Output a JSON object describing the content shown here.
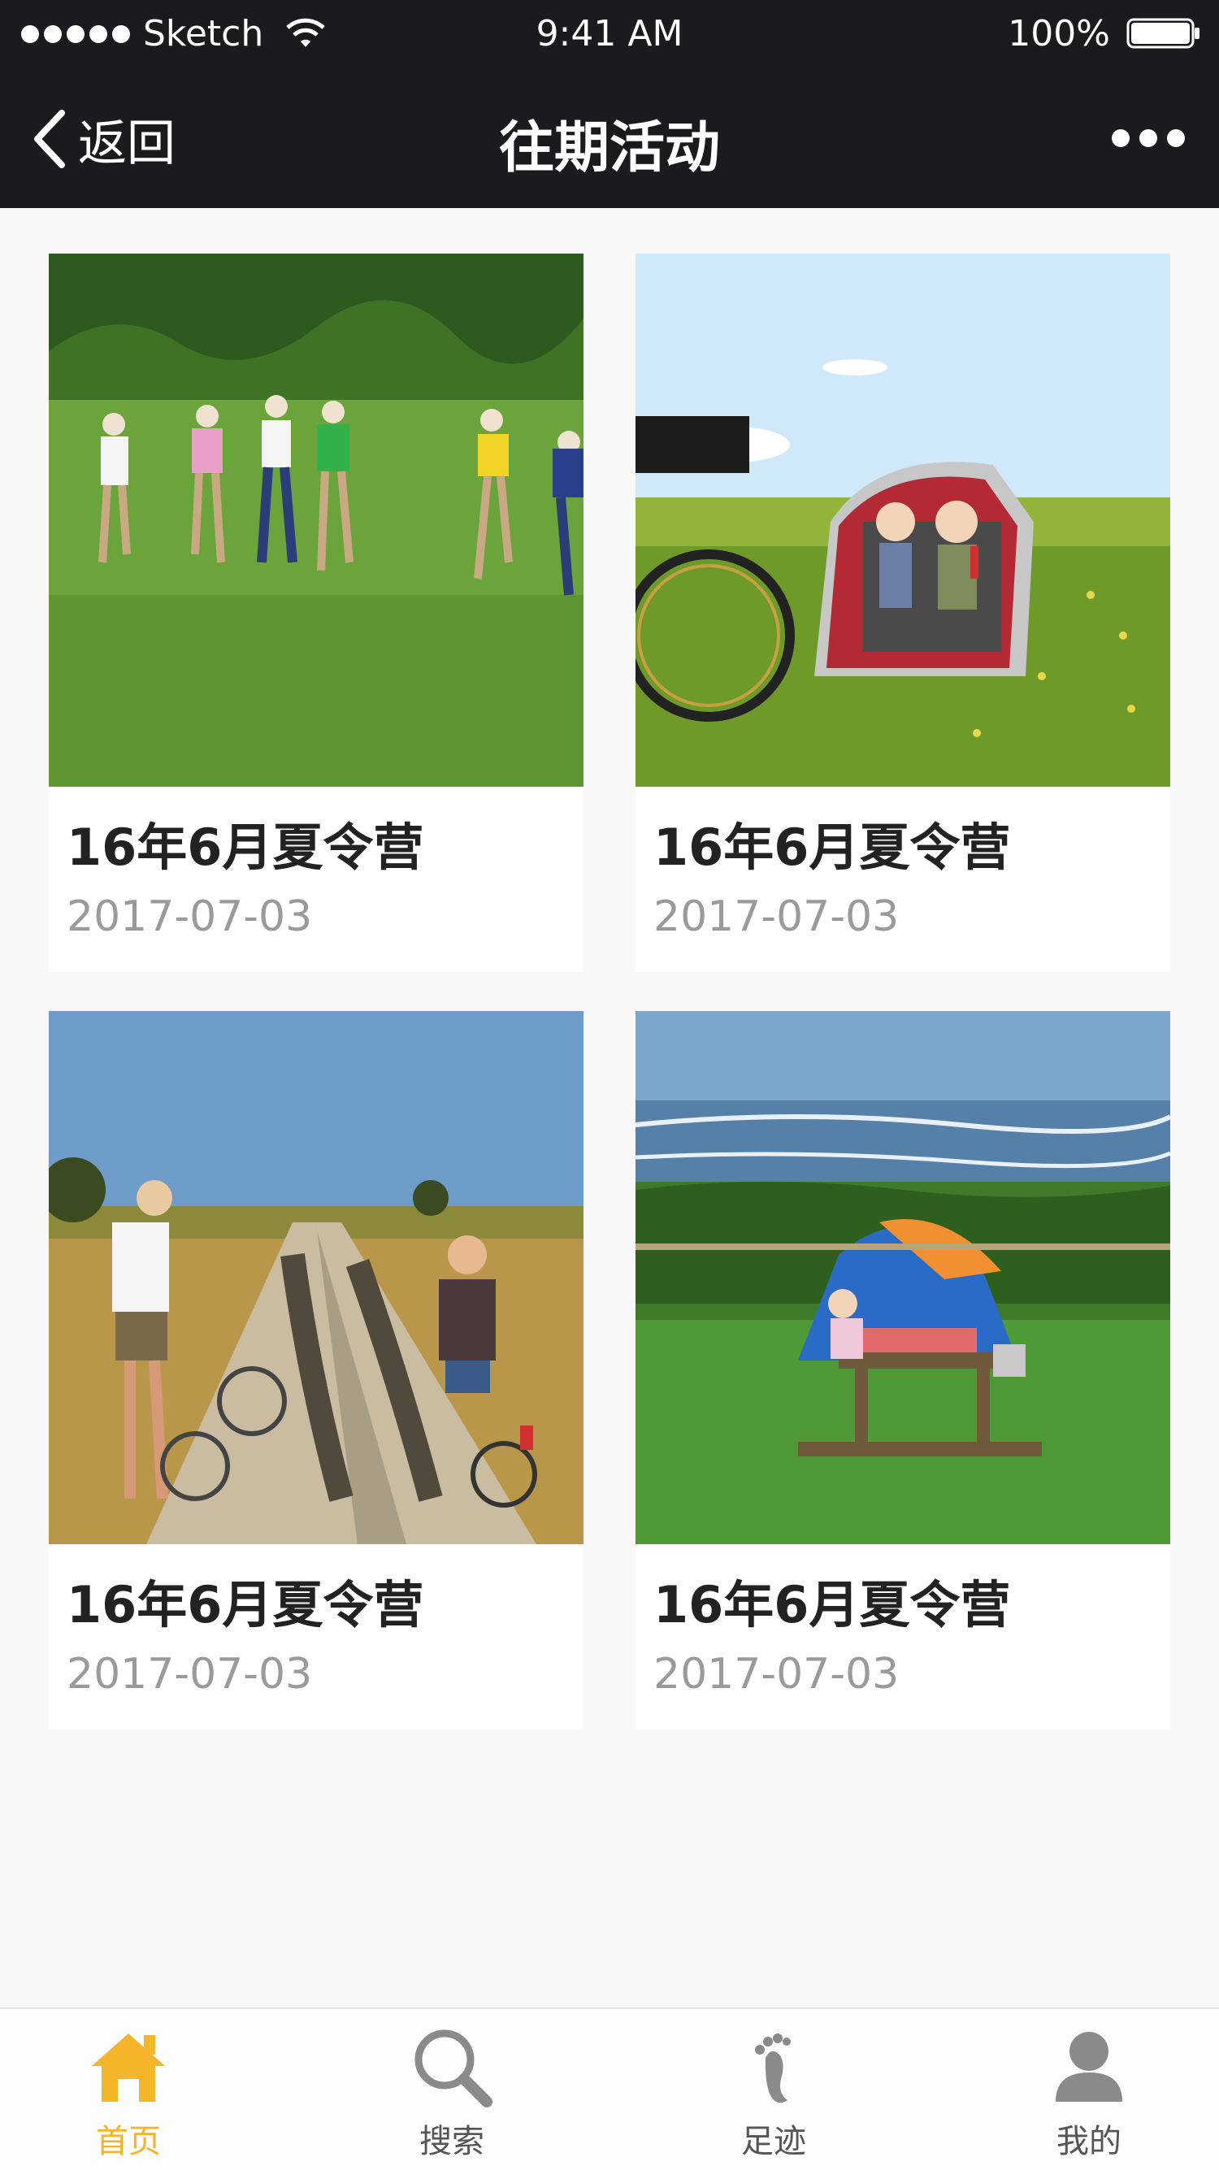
{
  "status_bar": {
    "carrier": "Sketch",
    "time": "9:41 AM",
    "battery": "100%"
  },
  "nav": {
    "back_label": "返回",
    "title": "往期活动"
  },
  "cards": [
    {
      "title": "16年6月夏令营",
      "date": "2017-07-03",
      "image": "children-running-on-grass"
    },
    {
      "title": "16年6月夏令营",
      "date": "2017-07-03",
      "image": "kids-in-bike-trailer"
    },
    {
      "title": "16年6月夏令营",
      "date": "2017-07-03",
      "image": "mother-and-child-with-bicycles"
    },
    {
      "title": "16年6月夏令营",
      "date": "2017-07-03",
      "image": "camping-tent-by-sea"
    }
  ],
  "tabbar": {
    "items": [
      {
        "label": "首页",
        "icon": "home-icon",
        "active": true
      },
      {
        "label": "搜索",
        "icon": "search-icon",
        "active": false
      },
      {
        "label": "足迹",
        "icon": "footprint-icon",
        "active": false
      },
      {
        "label": "我的",
        "icon": "user-icon",
        "active": false
      }
    ]
  },
  "colors": {
    "nav_background": "#1b1a1f",
    "accent": "#f5b52a",
    "page_background": "#f8f8f8"
  }
}
